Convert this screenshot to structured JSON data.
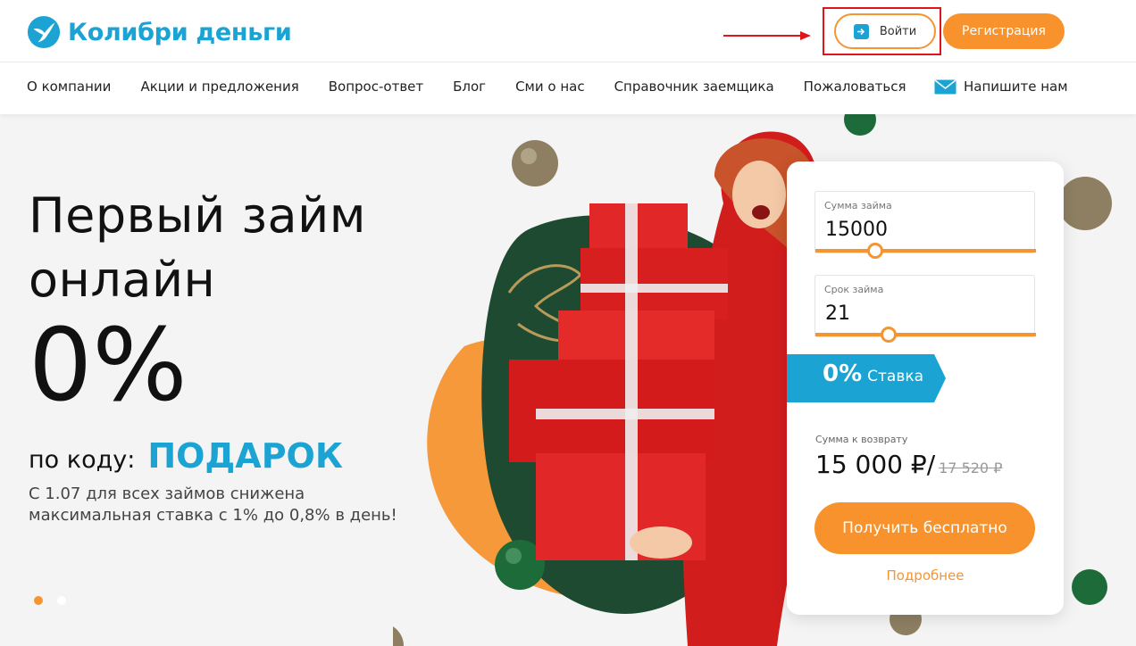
{
  "header": {
    "logo_text": "Колибри деньги",
    "login_label": "Войти",
    "register_label": "Регистрация",
    "nav": [
      {
        "label": "О компании"
      },
      {
        "label": "Акции и предложения"
      },
      {
        "label": "Вопрос-ответ"
      },
      {
        "label": "Блог"
      },
      {
        "label": "Сми о нас"
      },
      {
        "label": "Справочник заемщика"
      },
      {
        "label": "Пожаловаться"
      }
    ],
    "write_us": "Напишите нам"
  },
  "hero": {
    "title_line1": "Первый займ",
    "title_line2": "онлайн",
    "percent": "0%",
    "code_label": "по коду:",
    "code_value": "ПОДАРОК",
    "subtext": "С 1.07 для всех займов снижена максимальная ставка с 1% до 0,8% в день!",
    "slides_total": 2,
    "slide_active": 1
  },
  "calculator": {
    "amount_label": "Сумма займа",
    "amount_value": "15000",
    "amount_slider_fraction": 0.27,
    "term_label": "Срок займа",
    "term_value": "21",
    "term_slider_fraction": 0.33,
    "rate_percent": "0%",
    "rate_label": "Ставка",
    "return_label": "Сумма к возврату",
    "return_amount": "15 000 ₽/",
    "return_old": "17 520 ₽",
    "cta_label": "Получить бесплатно",
    "more_label": "Подробнее"
  },
  "colors": {
    "brand_blue": "#1aa3d3",
    "accent_orange": "#f8922d",
    "annotation_red": "#e0141b",
    "blob_green": "#1d4a30"
  },
  "icons": [
    "hummingbird-logo-icon",
    "login-arrow-icon",
    "mail-icon",
    "annotation-arrow-icon"
  ]
}
